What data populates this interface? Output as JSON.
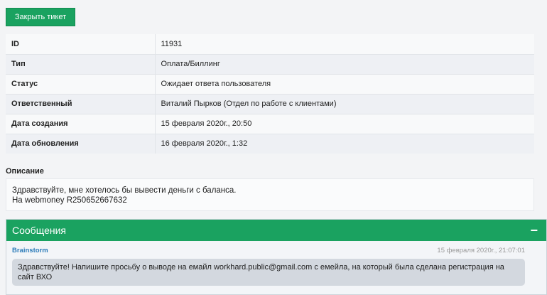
{
  "actions": {
    "close_ticket": "Закрыть тикет"
  },
  "ticket": {
    "rows": [
      {
        "key": "ID",
        "value": "11931"
      },
      {
        "key": "Тип",
        "value": "Оплата/Биллинг"
      },
      {
        "key": "Статус",
        "value": "Ожидает ответа пользователя"
      },
      {
        "key": "Ответственный",
        "value": "Виталий Пырков (Отдел по работе с клиентами)"
      },
      {
        "key": "Дата создания",
        "value": "15 февраля 2020г., 20:50"
      },
      {
        "key": "Дата обновления",
        "value": "16 февраля 2020г., 1:32"
      }
    ]
  },
  "description": {
    "label": "Описание",
    "lines": [
      "Здравствуйте, мне хотелось бы вывести деньги с баланса.",
      "На webmoney R250652667632"
    ]
  },
  "messages": {
    "title": "Сообщения",
    "collapse_symbol": "−",
    "items": [
      {
        "author": "Brainstorm",
        "date": "15 февраля 2020г., 21:07:01",
        "text": "Здравствуйте! Напишите просьбу о выводе на емайл workhard.public@gmail.com с емейла, на который была сделана регистрация на сайт ВХО"
      }
    ]
  },
  "colors": {
    "accent": "#1aa260",
    "link": "#2b7bb9"
  }
}
